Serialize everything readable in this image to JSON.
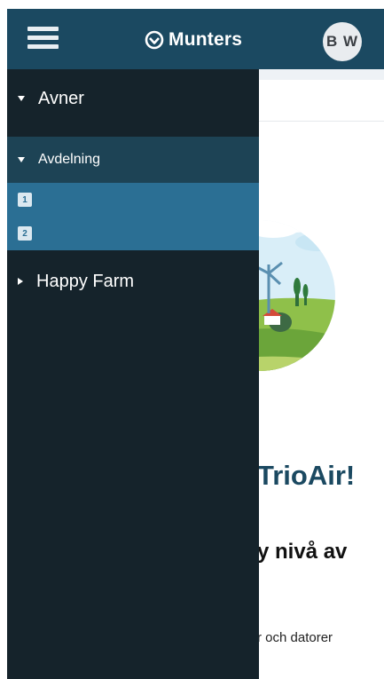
{
  "header": {
    "brand": "Munters",
    "user_initials": "B W"
  },
  "drawer": {
    "items": [
      {
        "label": "Avner",
        "expanded": true
      },
      {
        "label": "Avdelning",
        "expanded": true,
        "rooms": [
          "1",
          "2"
        ]
      },
      {
        "label": "Happy Farm",
        "expanded": false
      }
    ]
  },
  "welcome": {
    "title_fragment": "TrioAir!",
    "subtitle_fragment": "y nivå av",
    "body_fragment": "r och datorer"
  },
  "colors": {
    "topbar": "#1b4961",
    "drawer_bg": "#15232b",
    "drawer_section": "#1d4355",
    "drawer_selected": "#2b6f94"
  }
}
